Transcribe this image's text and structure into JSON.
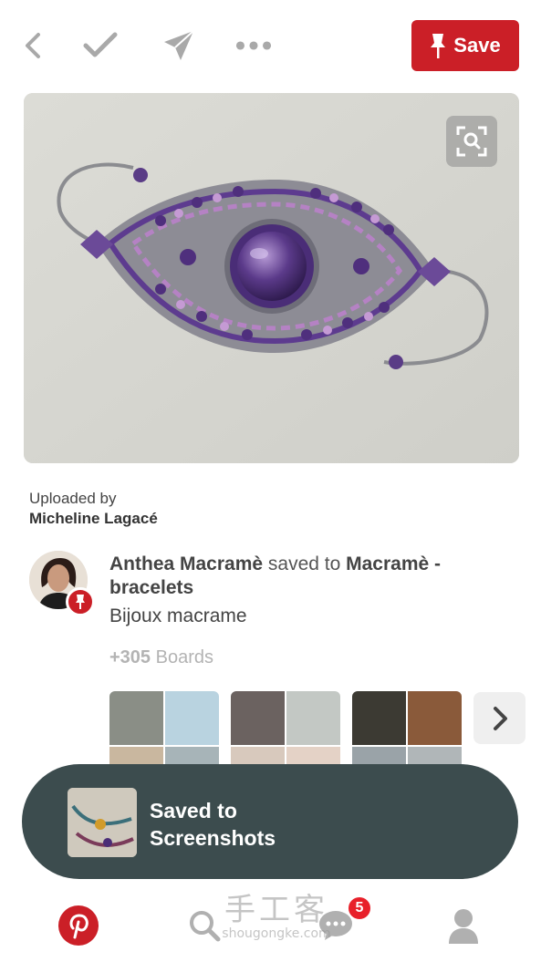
{
  "header": {
    "save_label": "Save",
    "accent_color": "#cb1f27"
  },
  "pin": {
    "uploaded_by_label": "Uploaded by",
    "uploader_name": "Micheline Lagacé"
  },
  "saved_activity": {
    "user_name": "Anthea Macramè",
    "saved_to_text": " saved to ",
    "board_name": "Macramè - bracelets",
    "description": "Bijoux macrame",
    "boards_count": "+305",
    "boards_label": " Boards"
  },
  "toast": {
    "line1": "Saved to",
    "line2": "Screenshots"
  },
  "nav": {
    "notification_count": "5"
  },
  "watermark": {
    "cn": "手工客",
    "url": "shougongke.com"
  },
  "icons": [
    "back-icon",
    "check-icon",
    "send-icon",
    "more-icon",
    "pin-icon",
    "visual-search-icon",
    "chevron-right-icon",
    "pinterest-logo-icon",
    "search-icon",
    "chat-icon",
    "profile-icon"
  ]
}
